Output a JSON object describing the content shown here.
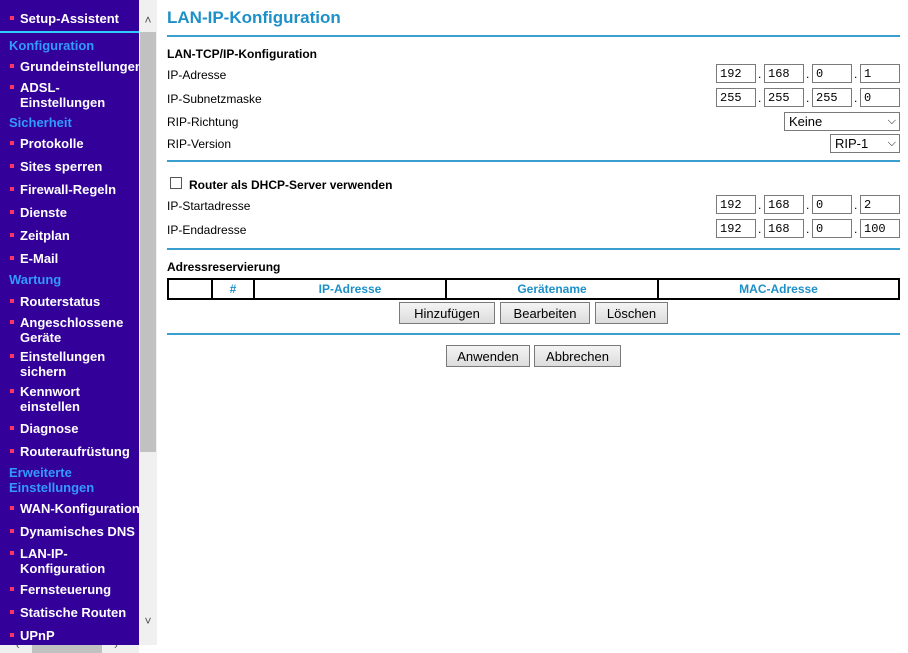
{
  "sidebar": {
    "setup": "Setup-Assistent",
    "sections": {
      "konfiguration": "Konfiguration",
      "sicherheit": "Sicherheit",
      "wartung": "Wartung",
      "erweitert": "Erweiterte Einstellungen"
    },
    "items": {
      "grund": "Grundeinstellungen",
      "adsl": "ADSL-Einstellungen",
      "protokolle": "Protokolle",
      "sites": "Sites sperren",
      "firewall": "Firewall-Regeln",
      "dienste": "Dienste",
      "zeitplan": "Zeitplan",
      "email": "E-Mail",
      "routerstatus": "Routerstatus",
      "geraete": "Angeschlossene Geräte",
      "sichern": "Einstellungen sichern",
      "kennwort": "Kennwort einstellen",
      "diagnose": "Diagnose",
      "aufruestung": "Routeraufrüstung",
      "wan": "WAN-Konfiguration",
      "ddns": "Dynamisches DNS",
      "lanip": "LAN-IP-Konfiguration",
      "fern": "Fernsteuerung",
      "routen": "Statische Routen",
      "upnp": "UPnP"
    }
  },
  "page": {
    "title": "LAN-IP-Konfiguration",
    "lan_section": "LAN-TCP/IP-Konfiguration",
    "ip_label": "IP-Adresse",
    "ip": [
      "192",
      "168",
      "0",
      "1"
    ],
    "mask_label": "IP-Subnetzmaske",
    "mask": [
      "255",
      "255",
      "255",
      "0"
    ],
    "rip_dir_label": "RIP-Richtung",
    "rip_dir_value": "Keine",
    "rip_ver_label": "RIP-Version",
    "rip_ver_value": "RIP-1",
    "dhcp_label": "Router als DHCP-Server verwenden",
    "dhcp_checked": false,
    "start_label": "IP-Startadresse",
    "start": [
      "192",
      "168",
      "0",
      "2"
    ],
    "end_label": "IP-Endadresse",
    "end": [
      "192",
      "168",
      "0",
      "100"
    ],
    "resv_title": "Adressreservierung",
    "table_headers": [
      "",
      "#",
      "IP-Adresse",
      "Gerätename",
      "MAC-Adresse"
    ],
    "btn_add": "Hinzufügen",
    "btn_edit": "Bearbeiten",
    "btn_delete": "Löschen",
    "btn_apply": "Anwenden",
    "btn_cancel": "Abbrechen"
  },
  "colors": {
    "sidebar_bg": "#330099",
    "accent": "#1e90c8",
    "bullet": "#ff3366"
  }
}
